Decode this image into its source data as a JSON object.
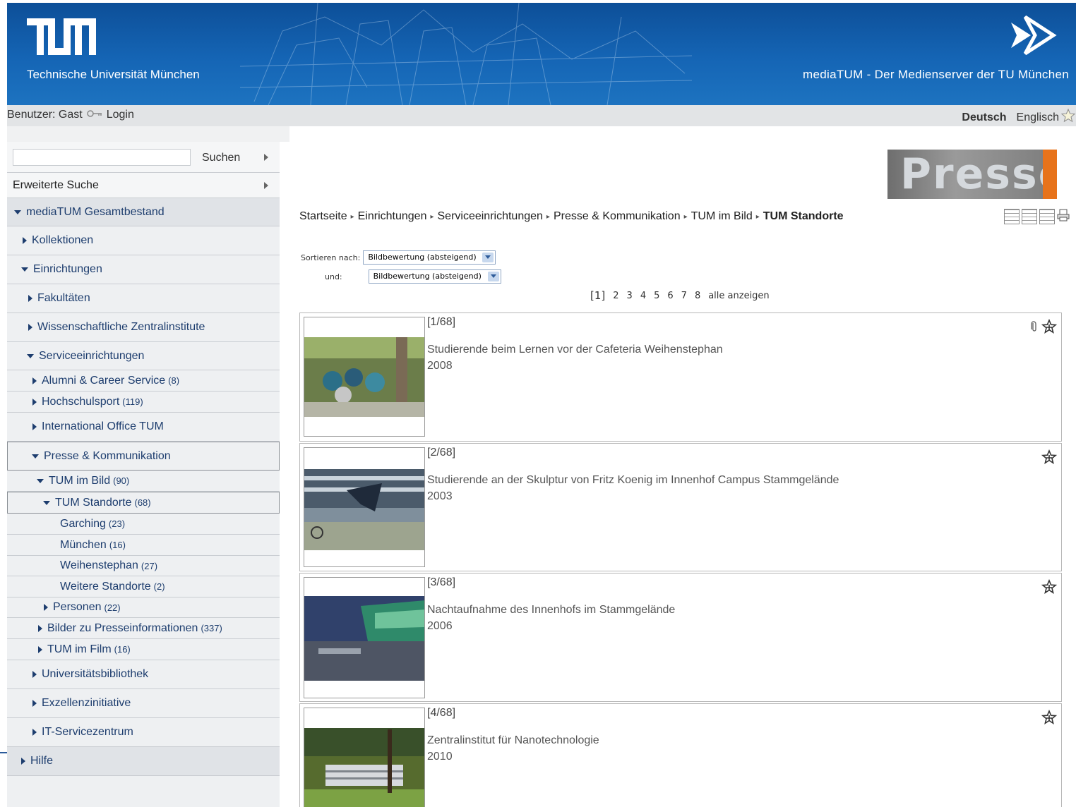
{
  "header": {
    "logo": "TUM",
    "university": "Technische Universität München",
    "service_title": "mediaTUM - Der Medienserver der TU München"
  },
  "userbar": {
    "user": "Benutzer: Gast",
    "login": "Login",
    "lang_current": "Deutsch",
    "lang_other": "Englisch"
  },
  "sidebar": {
    "search_button": "Suchen",
    "advanced_search": "Erweiterte Suche",
    "items": [
      {
        "label": "mediaTUM Gesamtbestand",
        "count": ""
      },
      {
        "label": "Kollektionen",
        "count": ""
      },
      {
        "label": "Einrichtungen",
        "count": ""
      },
      {
        "label": "Fakultäten",
        "count": ""
      },
      {
        "label": "Wissenschaftliche Zentralinstitute",
        "count": ""
      },
      {
        "label": "Serviceeinrichtungen",
        "count": ""
      },
      {
        "label": "Alumni & Career Service",
        "count": "(8)"
      },
      {
        "label": "Hochschulsport",
        "count": "(119)"
      },
      {
        "label": "International Office TUM",
        "count": ""
      },
      {
        "label": "Presse & Kommunikation",
        "count": ""
      },
      {
        "label": "TUM im Bild",
        "count": "(90)"
      },
      {
        "label": "TUM Standorte",
        "count": "(68)"
      },
      {
        "label": "Garching",
        "count": "(23)"
      },
      {
        "label": "München",
        "count": "(16)"
      },
      {
        "label": "Weihenstephan",
        "count": "(27)"
      },
      {
        "label": "Weitere Standorte",
        "count": "(2)"
      },
      {
        "label": "Personen",
        "count": "(22)"
      },
      {
        "label": "Bilder zu Presseinformationen",
        "count": "(337)"
      },
      {
        "label": "TUM im Film",
        "count": "(16)"
      },
      {
        "label": "Universitätsbibliothek",
        "count": ""
      },
      {
        "label": "Exzellenzinitiative",
        "count": ""
      },
      {
        "label": "IT-Servicezentrum",
        "count": ""
      },
      {
        "label": "Hilfe",
        "count": ""
      }
    ]
  },
  "main": {
    "banner": "Presse",
    "breadcrumb": [
      "Startseite",
      "Einrichtungen",
      "Serviceeinrichtungen",
      "Presse & Kommunikation",
      "TUM im Bild",
      "TUM Standorte"
    ],
    "sort_label": "Sortieren nach:",
    "sort_label2": "und:",
    "sort_value1": "Bildbewertung (absteigend)",
    "sort_value2": "Bildbewertung (absteigend)",
    "pager": {
      "current": "[1]",
      "pages": [
        "2",
        "3",
        "4",
        "5",
        "6",
        "7",
        "8"
      ],
      "all": "alle anzeigen"
    },
    "results": [
      {
        "index": "[1/68]",
        "title": "Studierende beim Lernen vor der Cafeteria Weihenstephan",
        "year": "2008"
      },
      {
        "index": "[2/68]",
        "title": "Studierende an der Skulptur von Fritz Koenig im Innenhof Campus Stammgelände",
        "year": "2003"
      },
      {
        "index": "[3/68]",
        "title": "Nachtaufnahme des Innenhofs im Stammgelände",
        "year": "2006"
      },
      {
        "index": "[4/68]",
        "title": "Zentralinstitut für Nanotechnologie",
        "year": "2010"
      }
    ]
  }
}
